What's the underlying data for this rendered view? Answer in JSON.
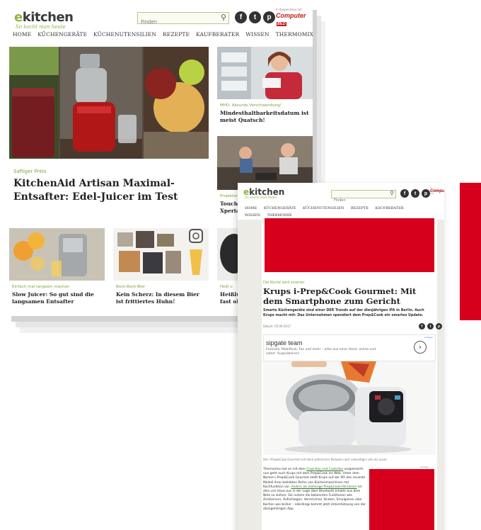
{
  "site": {
    "logo_e": "e",
    "logo_rest": "kitchen",
    "tagline": "So kocht man heute",
    "search_placeholder": "Finden",
    "coop_label": "In Kooperation mit",
    "partner_name": "Computer",
    "partner_badge": "BILD",
    "social_icons": [
      "facebook-icon",
      "twitter-icon",
      "pinterest-icon"
    ]
  },
  "nav": [
    "HOME",
    "KÜCHENGERÄTE",
    "KÜCHENUTENSILIEN",
    "REZEPTE",
    "KAUFBERATER",
    "WISSEN",
    "THERMOMIX"
  ],
  "hero": {
    "kicker": "Saftiger Preis",
    "title": "KitchenAid Artisan Maximal-Entsafter: Edel-Juicer im Test"
  },
  "side_cards": [
    {
      "kicker": "MHD: Absurde Verschwendung!",
      "title": "Mindesthaltbarkeitsdatum ist meist Quatsch!"
    },
    {
      "kicker": "Projektor",
      "title": "Touch Xperia"
    }
  ],
  "bottom_cards": [
    {
      "kicker": "Einfach mal langsam machen",
      "title": "Slow Juicer: So gut sind die langsamen Entsafter"
    },
    {
      "kicker": "Bock-Bock-Bier",
      "title": "Kein Scherz: In diesem Bier ist frittiertes Huhn!"
    },
    {
      "kicker": "Heiß u",
      "title": "Heißlu fast ol"
    }
  ],
  "article": {
    "kicker": "Die Küche wird smarter",
    "title": "Krups i-Prep&Cook Gourmet: Mit dem Smartphone zum Gericht",
    "subtitle": "Smarte Küchengeräte sind einer DER Trends auf der diesjährigen IFA in Berlin. Auch Krups macht mit: Das Unternehmen spendiert dem Prep&Cook ein smartes Update.",
    "date": "Datum: 05.09.2017",
    "caption": "Der i-Prep&Cook Gourmet soll dank zahlreicher Rezepte noch vielseitiger sein als zuvor.",
    "ad_label": "Anzeige",
    "body_1": "Thermomix hat es mit dem ",
    "body_link1": "Cook-Key und Cookidoo",
    "body_2": " vorgemacht: nun geht auch Krups mit dem Prep&Cook ins Web. Unter dem Namen i-Prep&Cook Gourmet stellt Krups auf der IFA das neueste Modell ihrer beliebten Reihe von Küchenmaschinen mit Kochfunktion vor. ",
    "body_link2": "Anders als bisherige Prep&Cook-Versionen",
    "body_3": " ist dies von Haus aus in der Lage über Bluetooth Inhalte aus dem Netz zu ziehen. Sie nutzen die bekannten Funktionen wie Zerkleinern, Aufschlagen, Vermischen, Braten, Emulgieren oder Kochen wie bisher – allerdings kommt jetzt Unterstützung von der dazugehörigen App."
  },
  "ad": {
    "badge": "Anzeige",
    "title": "sipgate team",
    "description": "Festnetz, Mobilfunk, Fax und mehr – alles aus einer Hand, online und sofort. Ausprobieren!",
    "arrow": "›"
  }
}
